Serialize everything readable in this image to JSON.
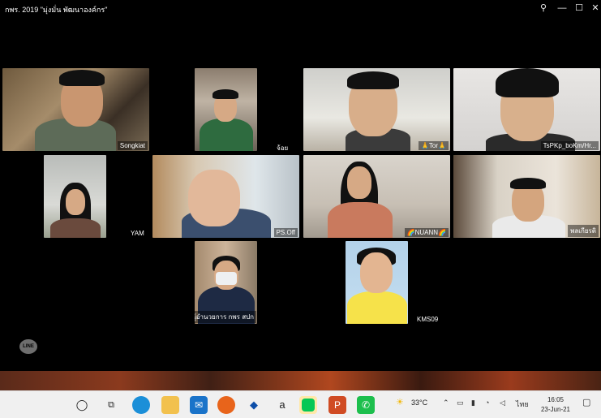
{
  "window": {
    "title": "กพร. 2019 \"มุ่งมั่น พัฒนาองค์กร\"",
    "pin_icon": "pin-icon",
    "minimize_glyph": "—",
    "maximize_glyph": "☐",
    "close_glyph": "✕"
  },
  "participants": [
    {
      "name": "Songkiat",
      "active": false
    },
    {
      "name": "จ้อย",
      "active": false
    },
    {
      "name": "🙏Tor🙏",
      "active": false
    },
    {
      "name": "TsPKp_boKm/Hr...",
      "active": false
    },
    {
      "name": "YAM",
      "active": false
    },
    {
      "name": "PS.Off",
      "active": false
    },
    {
      "name": "🌈NUANN🌈",
      "active": false
    },
    {
      "name": "พลเกียรติ",
      "active": true
    },
    {
      "name": "ผู้อำนวยการ กพร สปก",
      "active": false
    },
    {
      "name": "KMS09",
      "active": false
    }
  ],
  "line_logo": "LINE",
  "taskbar": {
    "icons": [
      "circle-search-icon",
      "task-view-icon",
      "edge-icon",
      "file-explorer-icon",
      "mail-icon",
      "firefox-icon",
      "dropbox-icon",
      "amazon-icon",
      "line-icon",
      "powerpoint-icon",
      "phone-icon"
    ],
    "weather": "33°C",
    "lang": "ไทย",
    "time": "16:05",
    "date": "23-Jun-21"
  },
  "colors": {
    "active_border": "#27c24c",
    "window_bg": "#000000",
    "taskbar_bg": "#f0f0f0"
  }
}
